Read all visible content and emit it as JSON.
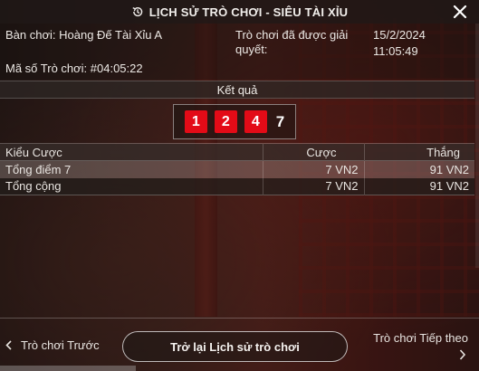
{
  "header": {
    "title": "LỊCH SỬ TRÒ CHƠI - SIÊU TÀI XỈU",
    "history_icon": "history-clock-icon",
    "close_icon": "close-icon"
  },
  "info": {
    "table_label": "Bàn chơi: Hoàng Đế Tài Xỉu A",
    "settled_label": "Trò chơi đã được giải quyết:",
    "settled_date": "15/2/2024",
    "settled_time": "11:05:49",
    "game_id_label": "Mã số Trò chơi: #04:05:22"
  },
  "result": {
    "heading": "Kết quả",
    "dice": [
      "1",
      "2",
      "4"
    ],
    "total": "7",
    "dice_color": "#e30b17"
  },
  "bets": {
    "columns": [
      "Kiểu Cược",
      "Cược",
      "Thắng"
    ],
    "rows": [
      {
        "type": "Tổng điểm 7",
        "bet": "7 VN2",
        "win": "91 VN2"
      },
      {
        "type": "Tổng cộng",
        "bet": "7 VN2",
        "win": "91 VN2"
      }
    ]
  },
  "footer": {
    "prev_label": "Trò chơi Trước",
    "back_label": "Trở lại Lịch sử trò chơi",
    "next_label": "Trò chơi Tiếp theo",
    "prev_icon": "chevron-left-icon",
    "next_icon": "chevron-right-icon"
  }
}
